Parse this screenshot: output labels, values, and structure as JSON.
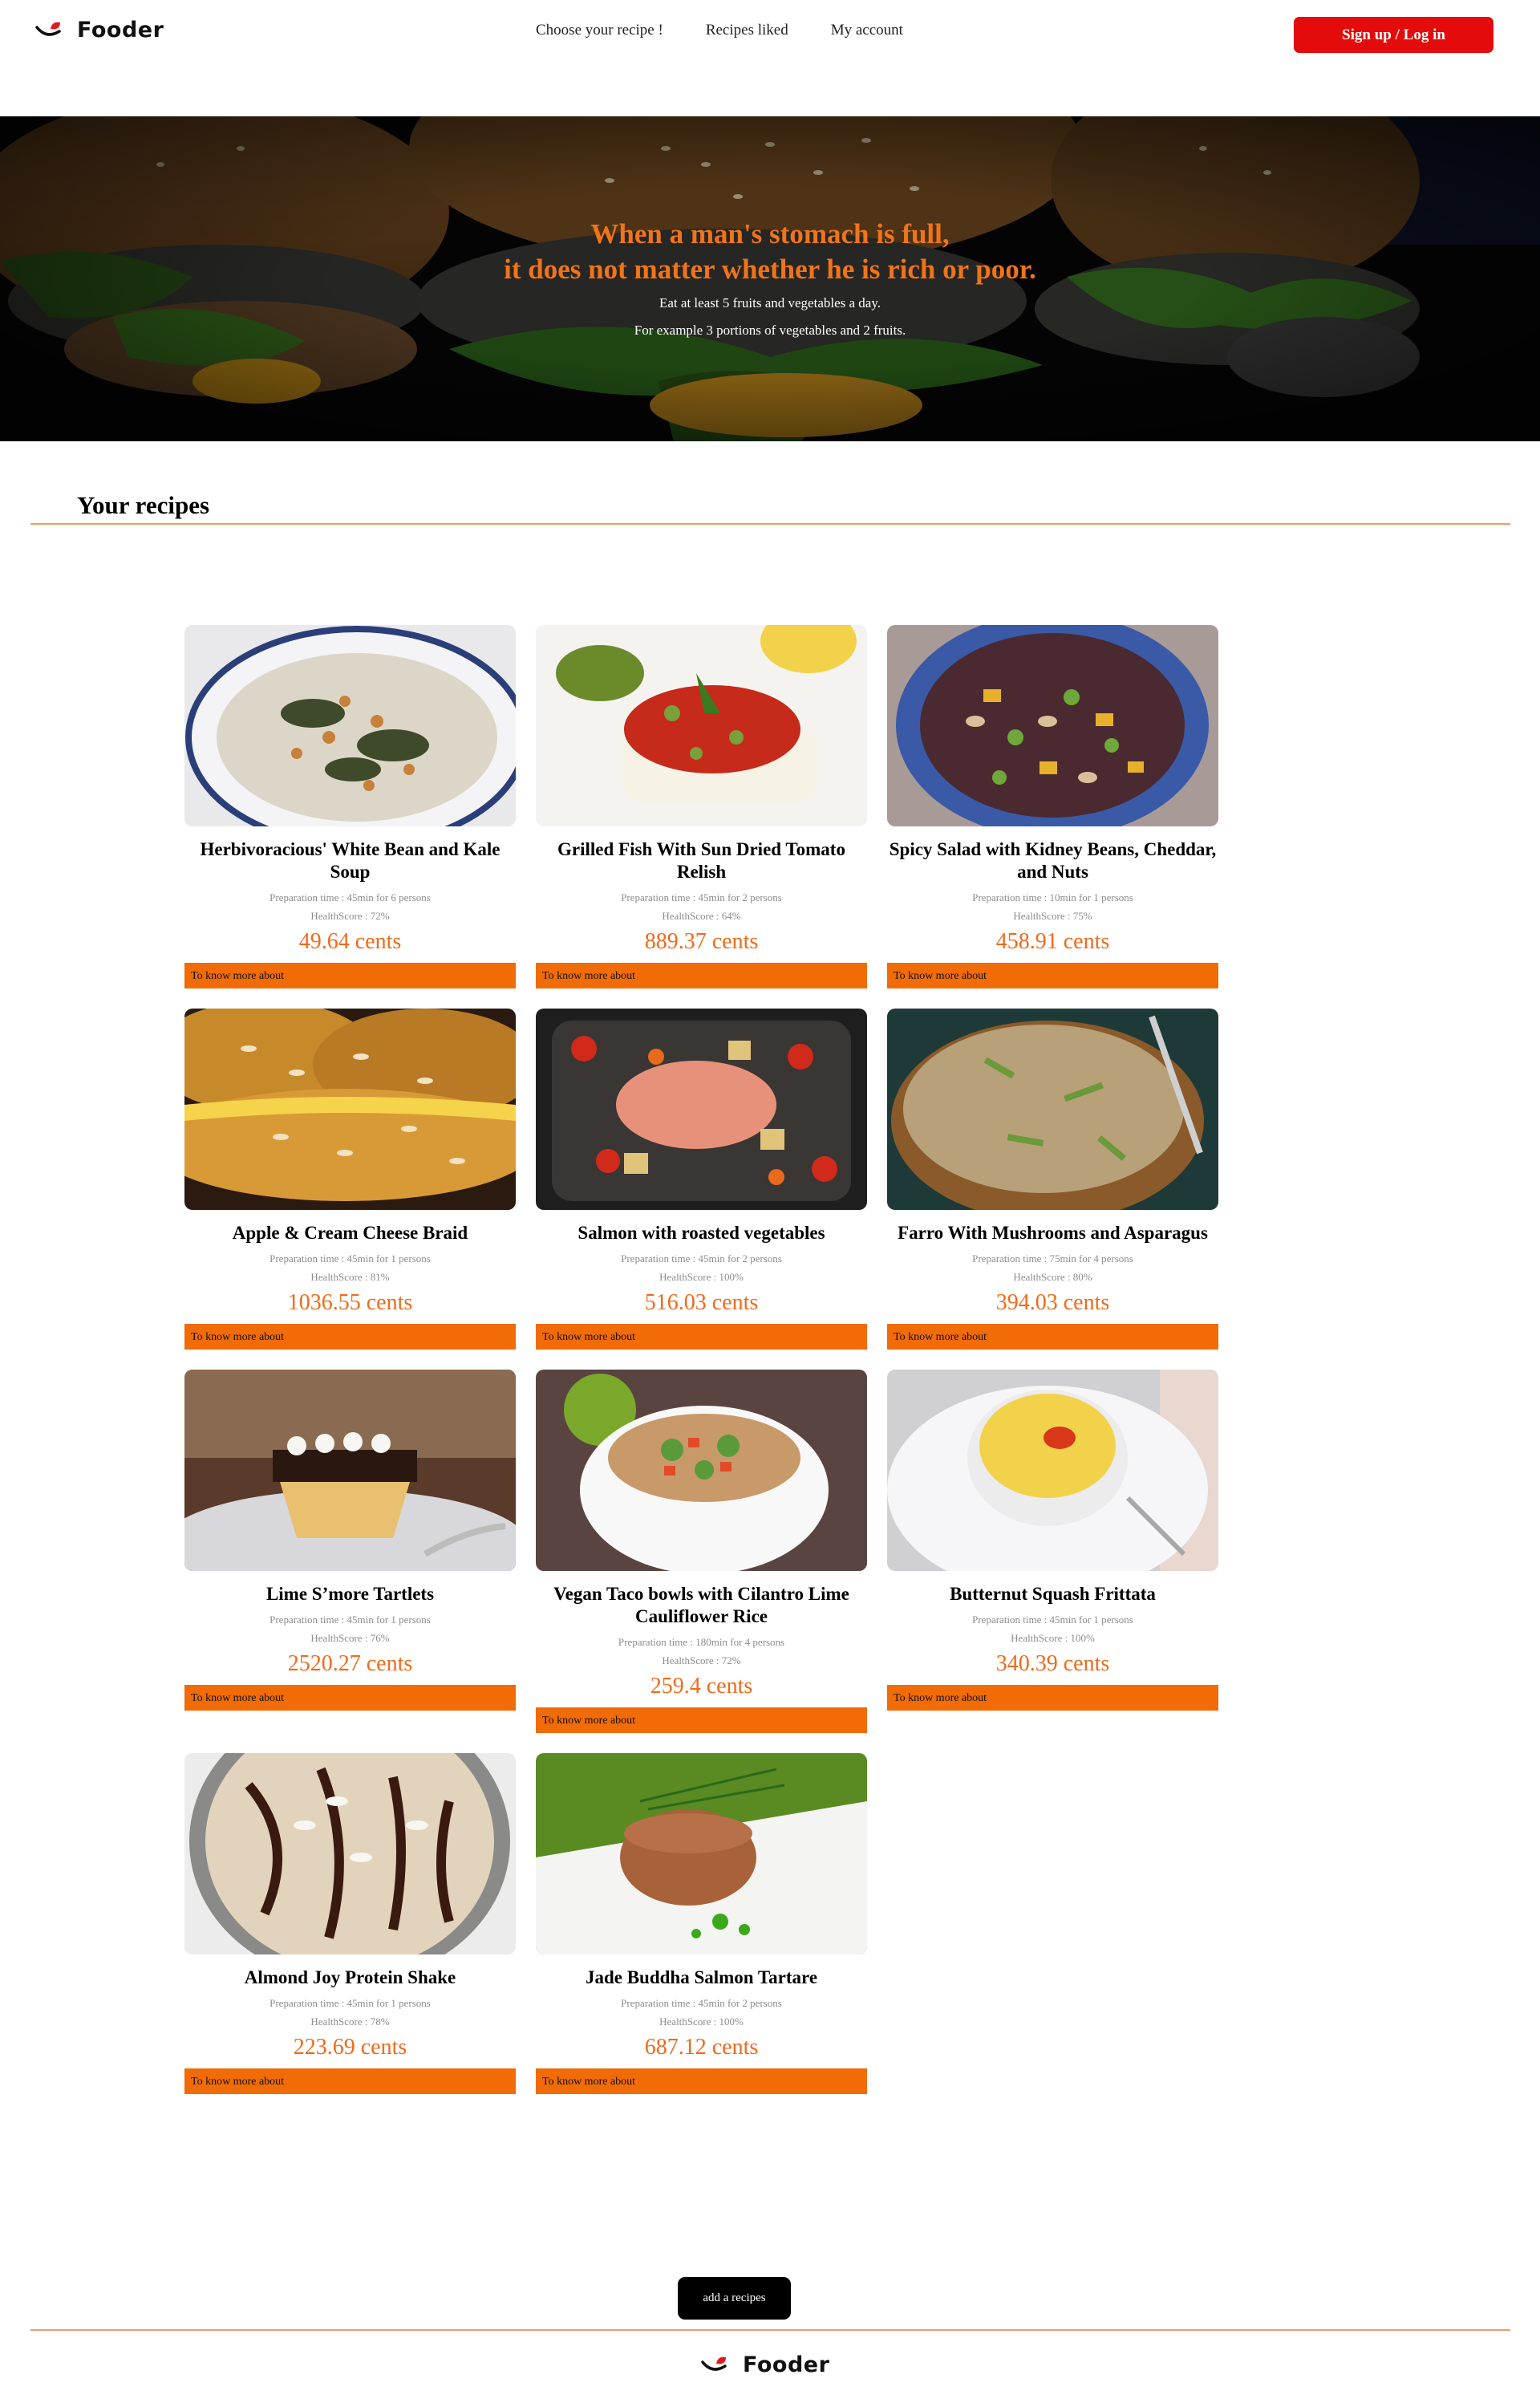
{
  "brand": {
    "name": "Fooder"
  },
  "nav": {
    "items": [
      {
        "label": "Choose your recipe !"
      },
      {
        "label": "Recipes liked"
      },
      {
        "label": "My account"
      }
    ],
    "signup_label": "Sign up / Log in"
  },
  "hero": {
    "title_line1": "When a man's stomach is full,",
    "title_line2": "it does not matter whether he is rich or poor.",
    "subtitle_line1": "Eat at least 5 fruits and vegetables a day.",
    "subtitle_line2": "For example 3 portions of vegetables and 2 fruits."
  },
  "section": {
    "title": "Your recipes"
  },
  "recipes": [
    {
      "title": "Herbivoracious' White Bean and Kale Soup",
      "prep": "Preparation time : 45min for 6 persons",
      "health": "HealthScore : 72%",
      "price": "49.64 cents",
      "button": "To know more about"
    },
    {
      "title": "Grilled Fish With Sun Dried Tomato Relish",
      "prep": "Preparation time : 45min for 2 persons",
      "health": "HealthScore : 64%",
      "price": "889.37 cents",
      "button": "To know more about"
    },
    {
      "title": "Spicy Salad with Kidney Beans, Cheddar, and Nuts",
      "prep": "Preparation time : 10min for 1 persons",
      "health": "HealthScore : 75%",
      "price": "458.91 cents",
      "button": "To know more about"
    },
    {
      "title": "Apple & Cream Cheese Braid",
      "prep": "Preparation time : 45min for 1 persons",
      "health": "HealthScore : 81%",
      "price": "1036.55 cents",
      "button": "To know more about"
    },
    {
      "title": "Salmon with roasted vegetables",
      "prep": "Preparation time : 45min for 2 persons",
      "health": "HealthScore : 100%",
      "price": "516.03 cents",
      "button": "To know more about"
    },
    {
      "title": "Farro With Mushrooms and Asparagus",
      "prep": "Preparation time : 75min for 4 persons",
      "health": "HealthScore : 80%",
      "price": "394.03 cents",
      "button": "To know more about"
    },
    {
      "title": "Lime S’more Tartlets",
      "prep": "Preparation time : 45min for 1 persons",
      "health": "HealthScore : 76%",
      "price": "2520.27 cents",
      "button": "To know more about"
    },
    {
      "title": "Vegan Taco bowls with Cilantro Lime Cauliflower Rice",
      "prep": "Preparation time : 180min for 4 persons",
      "health": "HealthScore : 72%",
      "price": "259.4 cents",
      "button": "To know more about"
    },
    {
      "title": "Butternut Squash Frittata",
      "prep": "Preparation time : 45min for 1 persons",
      "health": "HealthScore : 100%",
      "price": "340.39 cents",
      "button": "To know more about"
    },
    {
      "title": "Almond Joy Protein Shake",
      "prep": "Preparation time : 45min for 1 persons",
      "health": "HealthScore : 78%",
      "price": "223.69 cents",
      "button": "To know more about"
    },
    {
      "title": "Jade Buddha Salmon Tartare",
      "prep": "Preparation time : 45min for 2 persons",
      "health": "HealthScore : 100%",
      "price": "687.12 cents",
      "button": "To know more about"
    }
  ],
  "footer": {
    "add_label": "add a recipes"
  },
  "colors": {
    "accent": "#f16b06",
    "signup": "#e30b0b",
    "price": "#f06a1a"
  }
}
